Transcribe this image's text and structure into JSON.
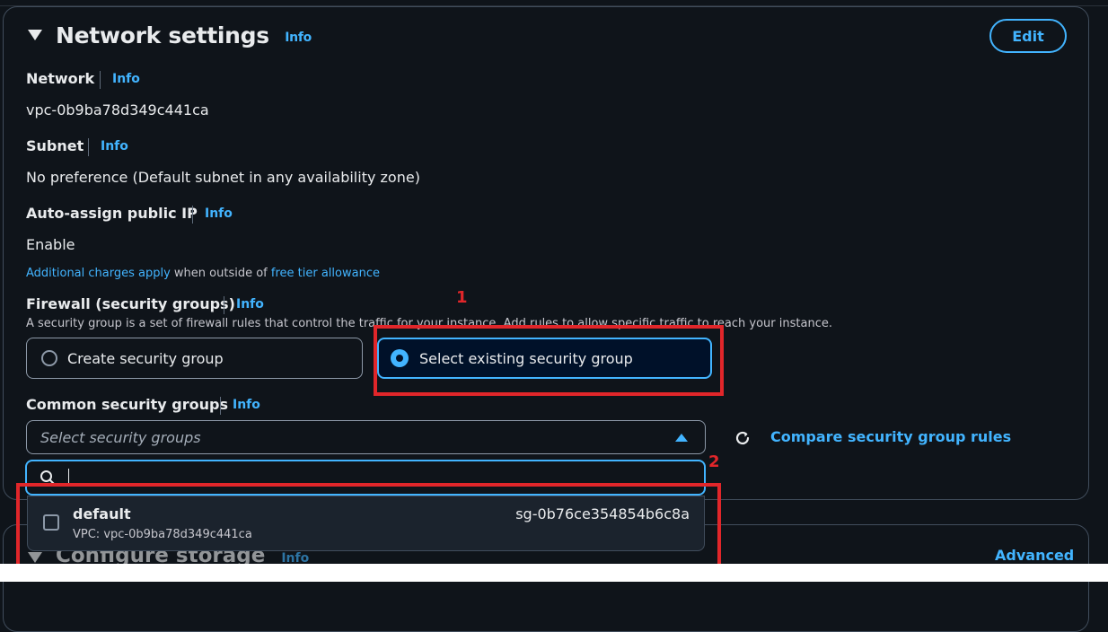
{
  "section": {
    "title": "Network settings",
    "info": "Info",
    "edit_label": "Edit"
  },
  "network": {
    "label": "Network",
    "info": "Info",
    "value": "vpc-0b9ba78d349c441ca"
  },
  "subnet": {
    "label": "Subnet",
    "info": "Info",
    "value": "No preference (Default subnet in any availability zone)"
  },
  "auto_ip": {
    "label": "Auto-assign public IP",
    "info": "Info",
    "value": "Enable",
    "note_link1": "Additional charges apply",
    "note_mid": " when outside of ",
    "note_link2": "free tier allowance"
  },
  "firewall": {
    "label": "Firewall (security groups)",
    "info": "Info",
    "description": "A security group is a set of firewall rules that control the traffic for your instance. Add rules to allow specific traffic to reach your instance.",
    "option_create": "Create security group",
    "option_select": "Select existing security group",
    "selected": "Select existing security group"
  },
  "common_sg": {
    "label": "Common security groups",
    "info": "Info",
    "placeholder": "Select security groups",
    "compare_label": "Compare security group rules",
    "search_value": "",
    "options": [
      {
        "name": "default",
        "vpc": "VPC: vpc-0b9ba78d349c441ca",
        "id": "sg-0b76ce354854b6c8a",
        "checked": false
      }
    ]
  },
  "annotations": {
    "marker1": "1",
    "marker2": "2",
    "color": "#e1262a"
  },
  "storage": {
    "title": "Configure storage",
    "info": "Info",
    "advanced_label": "Advanced"
  },
  "colors": {
    "accent": "#42b4ff",
    "background": "#0f141a",
    "text": "#e9ebed"
  },
  "icons": {
    "collapse": "caret-down-icon",
    "search": "search-icon",
    "refresh": "refresh-icon",
    "dropdown": "caret-up-icon"
  }
}
